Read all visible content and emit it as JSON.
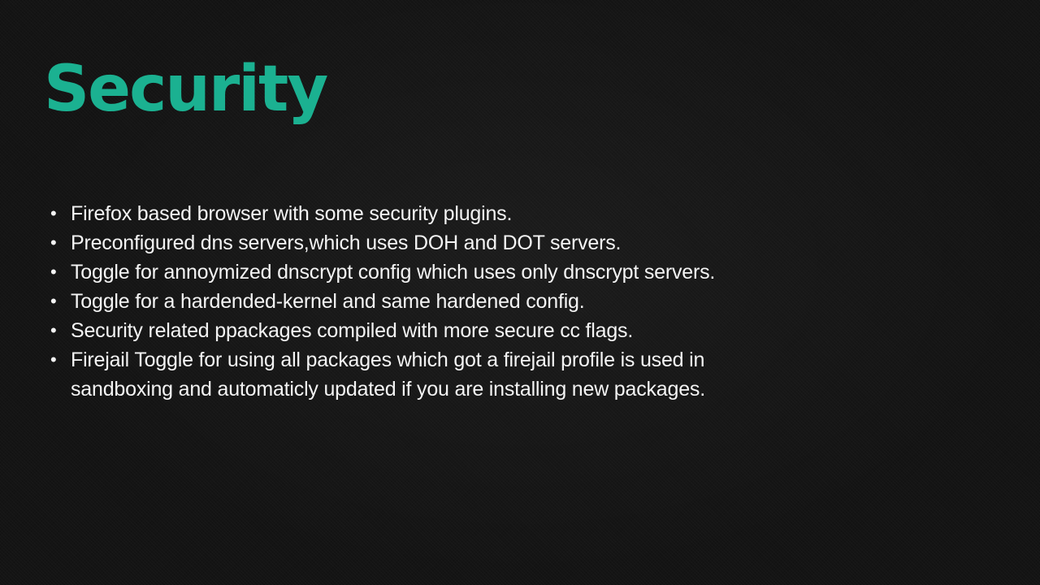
{
  "slide": {
    "title": "Security",
    "bullet_glyph": "•",
    "bullets": [
      "Firefox based browser with some security plugins.",
      "Preconfigured dns servers,which uses DOH and DOT servers.",
      "Toggle for annoymized dnscrypt config which uses only dnscrypt servers.",
      "Toggle for a hardended-kernel and same hardened config.",
      "Security related ppackages compiled with more secure cc flags.",
      "Firejail Toggle for using all packages which got a firejail profile is used in sandboxing and automaticly updated if you are installing new packages."
    ]
  },
  "colors": {
    "background": "#141414",
    "title": "#1bb191",
    "text": "#f4f4f4"
  }
}
